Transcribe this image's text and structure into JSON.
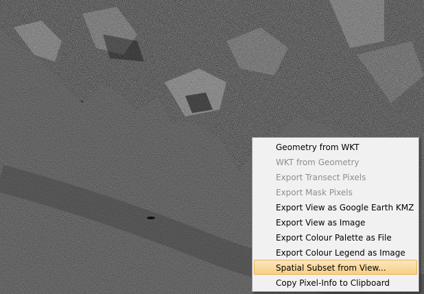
{
  "context_menu": {
    "items": [
      {
        "label": "Geometry from WKT",
        "enabled": true,
        "highlighted": false
      },
      {
        "label": "WKT from Geometry",
        "enabled": false,
        "highlighted": false
      },
      {
        "label": "Export Transect Pixels",
        "enabled": false,
        "highlighted": false
      },
      {
        "label": "Export Mask Pixels",
        "enabled": false,
        "highlighted": false
      },
      {
        "label": "Export View as Google Earth KMZ",
        "enabled": true,
        "highlighted": false
      },
      {
        "label": "Export View as Image",
        "enabled": true,
        "highlighted": false
      },
      {
        "label": "Export Colour Palette as File",
        "enabled": true,
        "highlighted": false
      },
      {
        "label": "Export Colour Legend as Image",
        "enabled": true,
        "highlighted": false
      },
      {
        "label": "Spatial Subset from View...",
        "enabled": true,
        "highlighted": true
      },
      {
        "label": "Copy Pixel-Info to Clipboard",
        "enabled": true,
        "highlighted": false
      }
    ]
  }
}
